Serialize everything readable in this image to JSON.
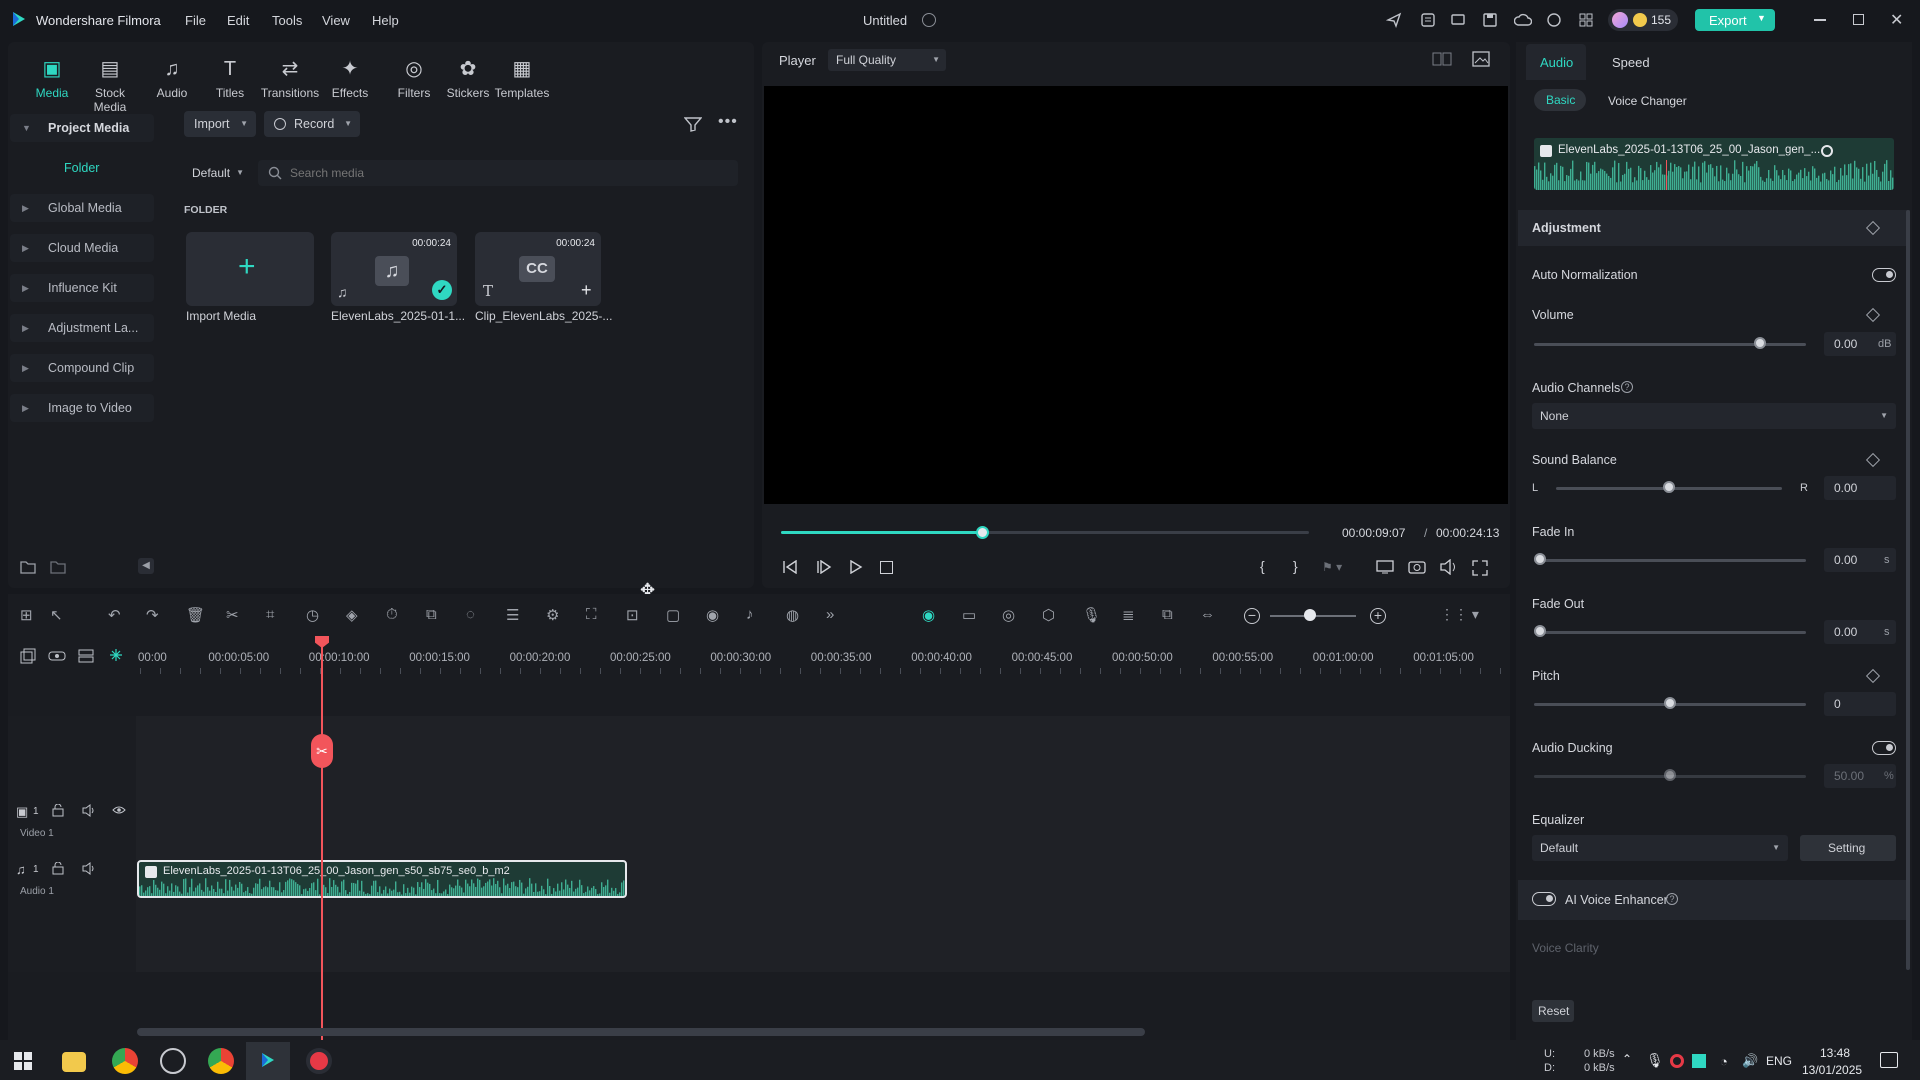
{
  "app": {
    "name": "Wondershare Filmora",
    "project_title": "Untitled",
    "credits": "155",
    "export_label": "Export"
  },
  "menu": [
    "File",
    "Edit",
    "Tools",
    "View",
    "Help"
  ],
  "toolbar_tabs": [
    {
      "label": "Media",
      "icon": "media-icon",
      "active": true
    },
    {
      "label": "Stock Media",
      "icon": "stock-media-icon"
    },
    {
      "label": "Audio",
      "icon": "audio-icon"
    },
    {
      "label": "Titles",
      "icon": "titles-icon"
    },
    {
      "label": "Transitions",
      "icon": "transitions-icon"
    },
    {
      "label": "Effects",
      "icon": "effects-icon"
    },
    {
      "label": "Filters",
      "icon": "filters-icon"
    },
    {
      "label": "Stickers",
      "icon": "stickers-icon"
    },
    {
      "label": "Templates",
      "icon": "templates-icon"
    }
  ],
  "sidebar": {
    "items": [
      {
        "label": "Project Media"
      },
      {
        "label": "Folder"
      },
      {
        "label": "Global Media"
      },
      {
        "label": "Cloud Media"
      },
      {
        "label": "Influence Kit"
      },
      {
        "label": "Adjustment La..."
      },
      {
        "label": "Compound Clip"
      },
      {
        "label": "Image to Video"
      }
    ]
  },
  "media": {
    "import_label": "Import",
    "record_label": "Record",
    "sort_label": "Default",
    "search_placeholder": "Search media",
    "folder_heading": "FOLDER",
    "items": [
      {
        "label": "Import Media"
      },
      {
        "label": "ElevenLabs_2025-01-1...",
        "duration": "00:00:24"
      },
      {
        "label": "Clip_ElevenLabs_2025-...",
        "duration": "00:00:24"
      }
    ]
  },
  "player": {
    "label": "Player",
    "quality": "Full Quality",
    "current_time": "00:00:09:07",
    "separator": "/",
    "total_time": "00:00:24:13",
    "progress": 0.38
  },
  "timeline": {
    "ruler": [
      "00:00",
      "00:00:05:00",
      "00:00:10:00",
      "00:00:15:00",
      "00:00:20:00",
      "00:00:25:00",
      "00:00:30:00",
      "00:00:35:00",
      "00:00:40:00",
      "00:00:45:00",
      "00:00:50:00",
      "00:00:55:00",
      "00:01:00:00",
      "00:01:05:00"
    ],
    "video_track": "Video 1",
    "audio_track": "Audio 1",
    "track_num": "1",
    "clip_name": "ElevenLabs_2025-01-13T06_25_00_Jason_gen_s50_sb75_se0_b_m2"
  },
  "right": {
    "tabs": [
      "Audio",
      "Speed"
    ],
    "subtabs": [
      "Basic",
      "Voice Changer"
    ],
    "clip_name": "ElevenLabs_2025-01-13T06_25_00_Jason_gen_...",
    "adjustment": "Adjustment",
    "auto_normalization": "Auto Normalization",
    "volume": {
      "label": "Volume",
      "value": "0.00",
      "unit": "dB",
      "level": 0.83
    },
    "audio_channels": {
      "label": "Audio Channels",
      "value": "None"
    },
    "sound_balance": {
      "label": "Sound Balance",
      "left": "L",
      "right": "R",
      "value": "0.00",
      "level": 0.5
    },
    "fade_in": {
      "label": "Fade In",
      "value": "0.00",
      "unit": "s"
    },
    "fade_out": {
      "label": "Fade Out",
      "value": "0.00",
      "unit": "s"
    },
    "pitch": {
      "label": "Pitch",
      "value": "0",
      "level": 0.5
    },
    "audio_ducking": {
      "label": "Audio Ducking",
      "value": "50.00",
      "unit": "%",
      "level": 0.5
    },
    "equalizer": {
      "label": "Equalizer",
      "value": "Default",
      "setting": "Setting"
    },
    "ai_voice_enhancer": "AI Voice Enhancer",
    "voice_clarity": "Voice Clarity",
    "reset": "Reset"
  },
  "taskbar": {
    "net_up": "0 kB/s",
    "net_down": "0 kB/s",
    "net_u": "U:",
    "net_d": "D:",
    "lang": "ENG",
    "time": "13:48",
    "date": "13/01/2025"
  },
  "colors": {
    "accent": "#2fd8c2",
    "playhead": "#f2555b",
    "audio_wave": "#3fae92",
    "export_btn": "#21c3a9"
  }
}
